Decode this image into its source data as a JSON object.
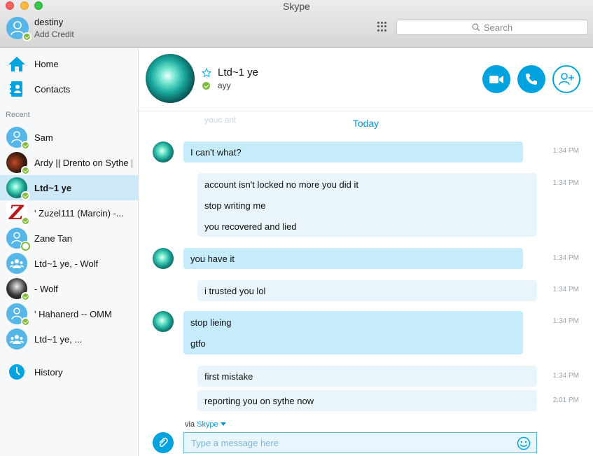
{
  "window": {
    "title": "Skype"
  },
  "profile": {
    "name": "destiny",
    "credit_label": "Add Credit"
  },
  "search": {
    "placeholder": "Search"
  },
  "nav": {
    "home": "Home",
    "contacts": "Contacts",
    "history": "History"
  },
  "recent": {
    "label": "Recent",
    "items": [
      {
        "name": "Sam"
      },
      {
        "name": "Ardy || Drento on Sythe ||"
      },
      {
        "name": "Ltd~1 ye"
      },
      {
        "name": "' Zuzel111 (Marcin) -..."
      },
      {
        "name": "Zane Tan"
      },
      {
        "name": "Ltd~1 ye, - Wolf"
      },
      {
        "name": "- Wolf"
      },
      {
        "name": "' Hahanerd -- OMM"
      },
      {
        "name": "Ltd~1 ye, ..."
      }
    ]
  },
  "conversation": {
    "name": "Ltd~1 ye",
    "mood": "ayy",
    "ghost_text": "youc ant",
    "date_divider": "Today",
    "messages": [
      {
        "lines": [
          "I can't what?"
        ],
        "time": "1:34 PM"
      },
      {
        "lines": [
          "account isn't locked no more you did it",
          "stop writing me",
          "you recovered and lied"
        ],
        "time": "1:34 PM"
      },
      {
        "lines": [
          "you have it"
        ],
        "time": "1:34 PM"
      },
      {
        "lines": [
          "i trusted you lol"
        ],
        "time": "1:34 PM"
      },
      {
        "lines": [
          "stop lieing",
          "gtfo"
        ],
        "time": "1:34 PM"
      },
      {
        "lines": [
          "first mistake"
        ],
        "time": "1:34 PM"
      },
      {
        "lines": [
          "reporting you on sythe now"
        ],
        "time": "2:01 PM"
      }
    ]
  },
  "composer": {
    "via_prefix": "via",
    "via_service": "Skype",
    "placeholder": "Type a message here"
  },
  "colors": {
    "accent": "#00a3e0",
    "incoming_bubble": "#c6ebfa",
    "outgoing_bubble": "#eaf5fb",
    "online": "#7fba3c"
  }
}
